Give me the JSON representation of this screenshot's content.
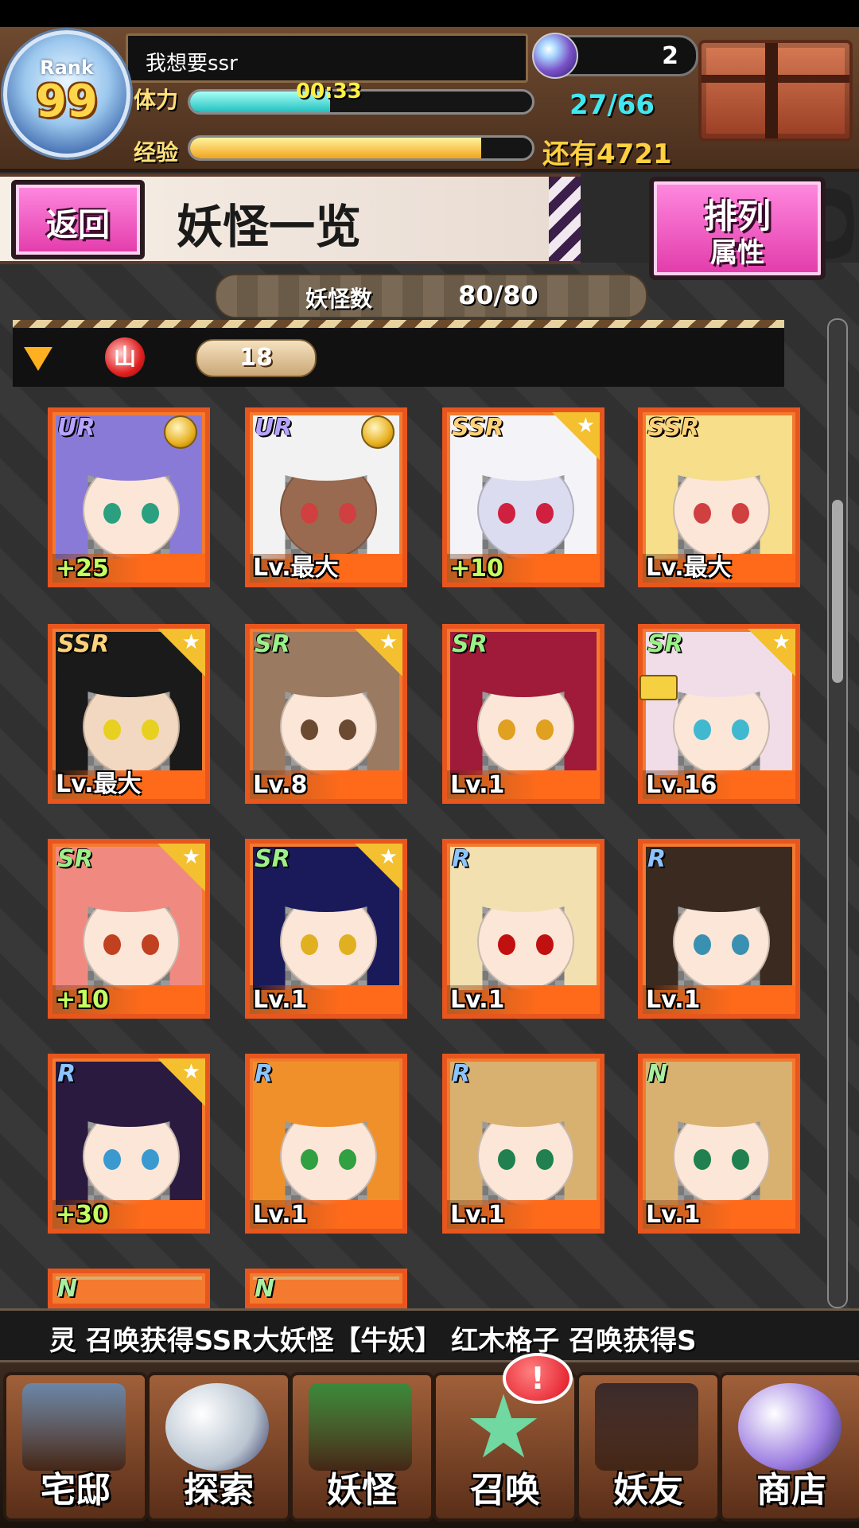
{
  "header": {
    "rank_label": "Rank",
    "rank_value": "99",
    "player_name": "我想要ssr",
    "gems": "2",
    "stamina_label": "体力",
    "stamina_timer": "00:33",
    "stamina_count": "27/66",
    "stamina_fraction": 0.41,
    "exp_label": "经验",
    "exp_remaining": "还有4721",
    "exp_fraction": 0.85
  },
  "title_bar": {
    "back_label": "返回",
    "title": "妖怪一览",
    "sort_label": "排列",
    "sort_value": "属性"
  },
  "count_bar": {
    "label": "妖怪数",
    "value": "80/80"
  },
  "filter": {
    "element_glyph": "山",
    "count": "18"
  },
  "cards": [
    {
      "rarity": "UR",
      "level": "+25",
      "badge": "medal",
      "hair": "#8a7ad8",
      "eye": "#2aa080",
      "skin": "#fbe6d8",
      "framed": true
    },
    {
      "rarity": "UR",
      "level": "Lv.最大",
      "badge": "medal",
      "hair": "#f2f2f2",
      "eye": "#d04040",
      "skin": "#9a6a50",
      "framed": true
    },
    {
      "rarity": "SSR",
      "level": "+10",
      "badge": "star",
      "hair": "#f4f4f8",
      "eye": "#d02040",
      "skin": "#dcdcf0",
      "framed": true
    },
    {
      "rarity": "SSR",
      "level": "Lv.最大",
      "badge": "none",
      "hair": "#f6de8a",
      "eye": "#d04040",
      "skin": "#fbe6d8",
      "framed": true
    },
    {
      "rarity": "SSR",
      "level": "Lv.最大",
      "badge": "star",
      "hair": "#1a1a1a",
      "eye": "#e8d020",
      "skin": "#f2d8c0",
      "framed": true
    },
    {
      "rarity": "SR",
      "level": "Lv.8",
      "badge": "star",
      "hair": "#9a7a60",
      "eye": "#6a4a30",
      "skin": "#fbe6d8",
      "framed": false
    },
    {
      "rarity": "SR",
      "level": "Lv.1",
      "badge": "none",
      "hair": "#a01a3a",
      "eye": "#e0a020",
      "skin": "#fbe6d8",
      "framed": false
    },
    {
      "rarity": "SR",
      "level": "Lv.16",
      "badge": "star",
      "hair": "#f0dde8",
      "eye": "#40b8d0",
      "skin": "#fbe6d8",
      "framed": false,
      "lock": true
    },
    {
      "rarity": "SR",
      "level": "+10",
      "badge": "star",
      "hair": "#f08a80",
      "eye": "#c04020",
      "skin": "#fbe6d8",
      "framed": false
    },
    {
      "rarity": "SR",
      "level": "Lv.1",
      "badge": "star",
      "hair": "#1a1a5a",
      "eye": "#e0b020",
      "skin": "#fbe6d8",
      "framed": false
    },
    {
      "rarity": "R",
      "level": "Lv.1",
      "badge": "none",
      "hair": "#f2e0b0",
      "eye": "#c01010",
      "skin": "#fbe6d8",
      "framed": false
    },
    {
      "rarity": "R",
      "level": "Lv.1",
      "badge": "none",
      "hair": "#3a2a20",
      "eye": "#3a90b0",
      "skin": "#fbe6d8",
      "framed": false
    },
    {
      "rarity": "R",
      "level": "+30",
      "badge": "star",
      "hair": "#2a1a40",
      "eye": "#3a9ad0",
      "skin": "#fbe6d8",
      "framed": true
    },
    {
      "rarity": "R",
      "level": "Lv.1",
      "badge": "none",
      "hair": "#f0902a",
      "eye": "#30a040",
      "skin": "#fbe6d8",
      "framed": false
    },
    {
      "rarity": "R",
      "level": "Lv.1",
      "badge": "none",
      "hair": "#d8b070",
      "eye": "#208050",
      "skin": "#fbe6d8",
      "framed": false
    },
    {
      "rarity": "N",
      "level": "Lv.1",
      "badge": "none",
      "hair": "#d8b070",
      "eye": "#208050",
      "skin": "#fbe6d8",
      "framed": false
    },
    {
      "rarity": "N",
      "level": "",
      "badge": "none",
      "hair": "#d8b070",
      "eye": "#208050",
      "skin": "#fbe6d8",
      "framed": false
    },
    {
      "rarity": "N",
      "level": "",
      "badge": "none",
      "hair": "#d8b070",
      "eye": "#208050",
      "skin": "#fbe6d8",
      "framed": false
    }
  ],
  "ticker": "灵 召唤获得SSR大妖怪【牛妖】    红木格子 召唤获得S",
  "nav": [
    {
      "label": "宅邸",
      "icon": "mansion-icon",
      "color": "#6a86a8"
    },
    {
      "label": "探索",
      "icon": "magnifier-icon",
      "color": "#b8c4d0"
    },
    {
      "label": "妖怪",
      "icon": "scroll-icon",
      "color": "#3a8a3a"
    },
    {
      "label": "召唤",
      "icon": "pentagram-icon",
      "color": "#70d8a0"
    },
    {
      "label": "妖友",
      "icon": "catgirl-icon",
      "color": "#3a2a2a"
    },
    {
      "label": "商店",
      "icon": "crystal-ball-icon",
      "color": "#9a7ae0"
    }
  ],
  "summon_alert": "!",
  "colors": {
    "accent_pink": "#e23aa9",
    "card_orange": "#f37a2e",
    "stamina": "#22c0c0",
    "exp": "#f3a41c"
  }
}
